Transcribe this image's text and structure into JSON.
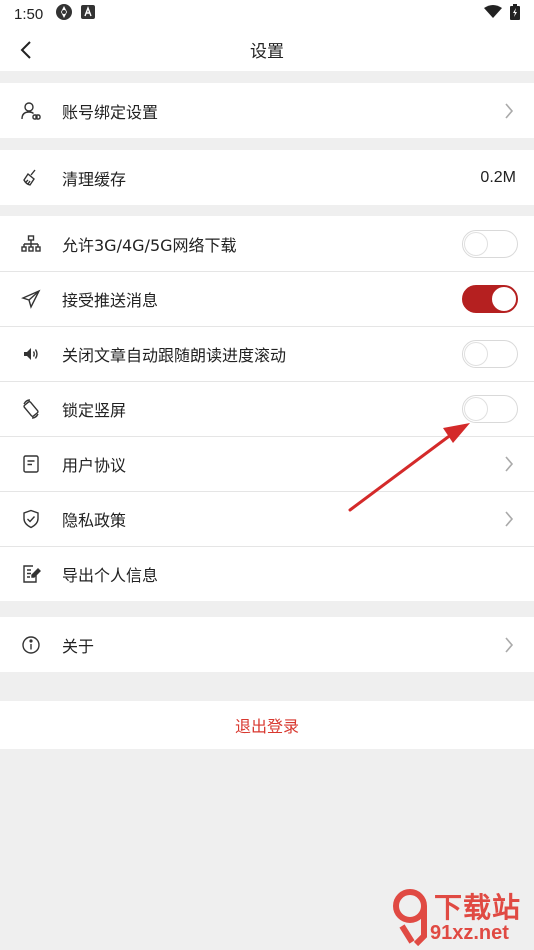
{
  "status_bar": {
    "time": "1:50"
  },
  "header": {
    "title": "设置"
  },
  "settings": {
    "account_binding": "账号绑定设置",
    "clear_cache": "清理缓存",
    "cache_size": "0.2M",
    "allow_mobile_download": "允许3G/4G/5G网络下载",
    "allow_mobile_download_on": false,
    "receive_push": "接受推送消息",
    "receive_push_on": true,
    "close_auto_scroll": "关闭文章自动跟随朗读进度滚动",
    "close_auto_scroll_on": false,
    "lock_portrait": "锁定竖屏",
    "lock_portrait_on": false,
    "user_agreement": "用户协议",
    "privacy_policy": "隐私政策",
    "export_personal_info": "导出个人信息",
    "about": "关于"
  },
  "logout": {
    "label": "退出登录"
  },
  "colors": {
    "accent": "#b52020",
    "logout": "#d8382f",
    "annotation_arrow": "#d42a2a"
  },
  "watermark": {
    "brand_top": "下载站",
    "brand_bottom": "91xz.net"
  }
}
